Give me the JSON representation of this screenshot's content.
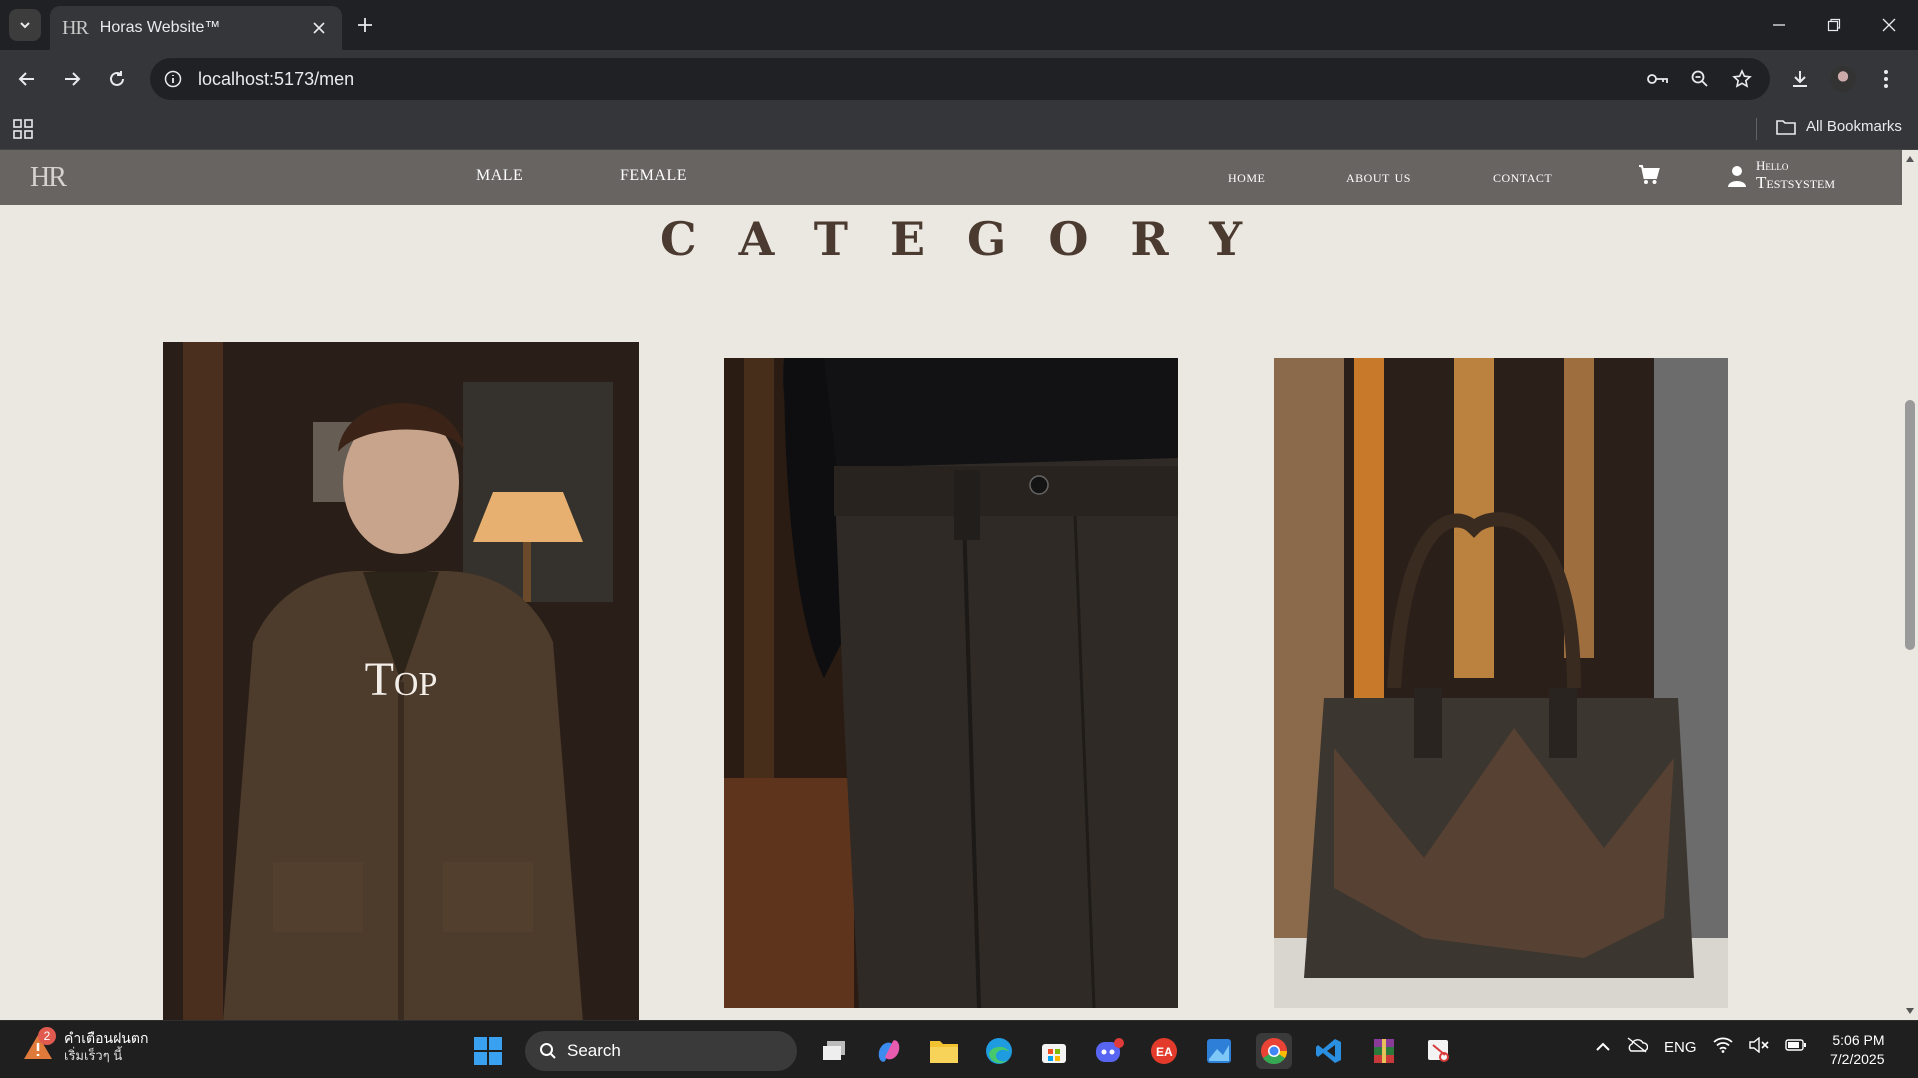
{
  "browser": {
    "tab_title": "Horas Website™",
    "tab_favicon": "HR",
    "url": "localhost:5173/men",
    "bookmarks_label": "All Bookmarks"
  },
  "site": {
    "logo": "HR",
    "nav_left": [
      "MALE",
      "FEMALE"
    ],
    "nav_right": [
      "Home",
      "About Us",
      "Contact"
    ],
    "greeting": "Hello",
    "username": "Testsystem"
  },
  "page": {
    "section_title": "CATEGORY",
    "cards": [
      {
        "label": "Top",
        "image": "man in brown knit cardigan"
      },
      {
        "label": "",
        "image": "dark wool trousers"
      },
      {
        "label": "",
        "image": "dark leather handbag"
      }
    ]
  },
  "taskbar": {
    "weather_badge": "2",
    "weather_title": "คำเตือนฝนตก",
    "weather_sub": "เริ่มเร็วๆ นี้",
    "search_label": "Search",
    "language": "ENG",
    "time": "5:06 PM",
    "date": "7/2/2025"
  }
}
